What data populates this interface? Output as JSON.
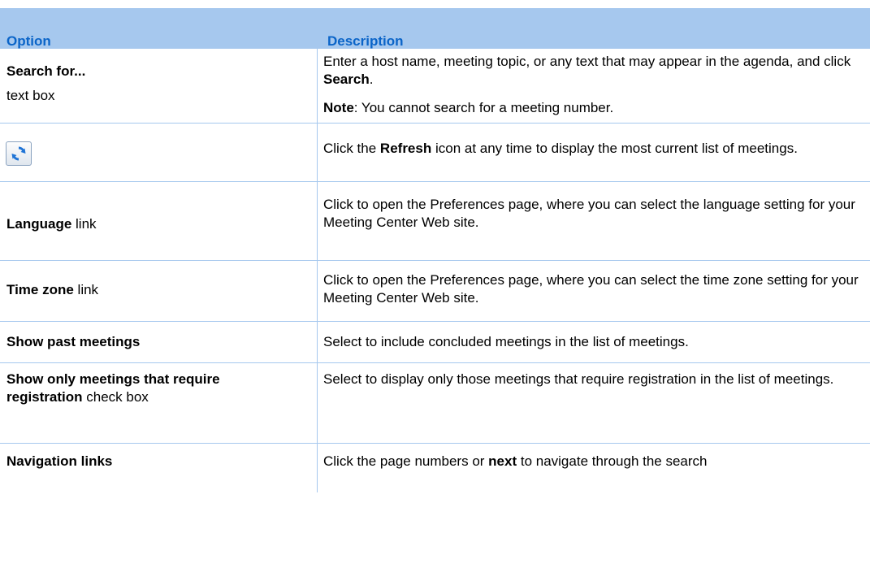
{
  "header": {
    "col_option": "Option",
    "col_description": "Description"
  },
  "rows": {
    "search": {
      "option_title": "Search for...",
      "option_sub": "text box",
      "desc_p1_a": "Enter a host name, meeting topic, or any text that may appear in the agenda, and click ",
      "desc_p1_bold": "Search",
      "desc_p1_b": ".",
      "desc_p2_bold": "Note",
      "desc_p2_a": ": You cannot search for a meeting number."
    },
    "refresh": {
      "icon": "refresh-icon",
      "desc_a": "Click the ",
      "desc_bold": "Refresh",
      "desc_b": " icon at any time to display the most current list of meetings."
    },
    "language": {
      "option_bold": "Language",
      "option_rest": " link",
      "desc": "Click to open the Preferences page, where you can select the language setting for your Meeting Center Web site."
    },
    "timezone": {
      "option_bold": "Time zone",
      "option_rest": " link",
      "desc": "Click to open the Preferences page, where you can select the time zone setting for your Meeting Center Web site."
    },
    "past": {
      "option_bold": "Show past meetings",
      "desc": "Select to include concluded meetings in the list of meetings."
    },
    "registration": {
      "option_bold": "Show only meetings that require registration",
      "option_rest": " check box",
      "desc": "Select to display only those meetings that require registration in the list of meetings."
    },
    "navigation": {
      "option_bold": "Navigation links",
      "desc_a": "Click the page numbers or ",
      "desc_bold": "next",
      "desc_b": " to navigate through the search"
    }
  }
}
